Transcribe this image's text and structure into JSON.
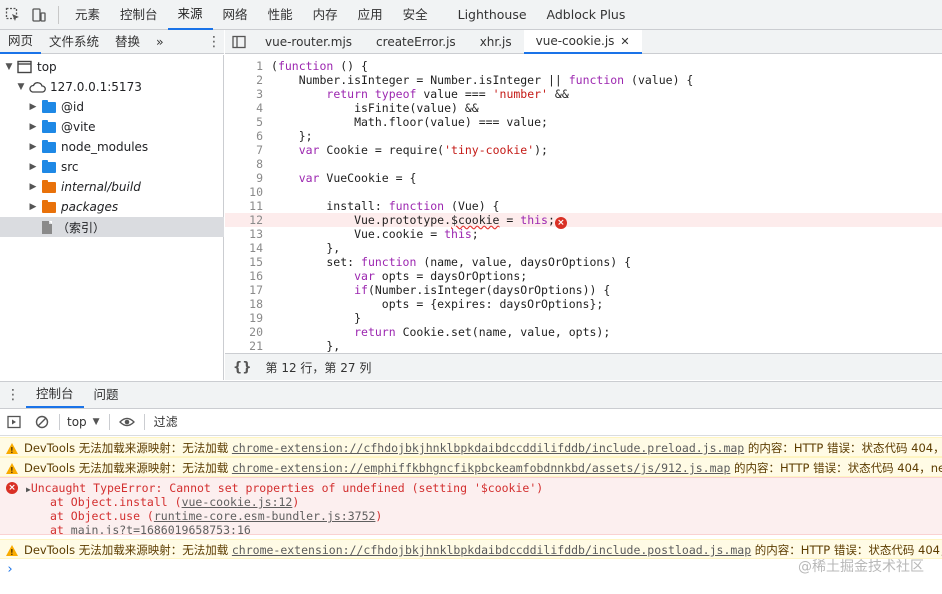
{
  "topbar": {
    "tabs": [
      "元素",
      "控制台",
      "来源",
      "网络",
      "性能",
      "内存",
      "应用",
      "安全",
      "Lighthouse",
      "Adblock Plus"
    ],
    "active_tab": "来源"
  },
  "navigator": {
    "tabs": [
      "网页",
      "文件系统",
      "替换"
    ],
    "more": "»",
    "kebab": "⋮",
    "tree": [
      {
        "label": "top",
        "icon": "frame-icon",
        "level": 0,
        "expanded": true
      },
      {
        "label": "127.0.0.1:5173",
        "icon": "cloud-icon",
        "level": 1,
        "expanded": true
      },
      {
        "label": "@id",
        "icon": "folder-icon",
        "color": "#1e88e5",
        "level": 2
      },
      {
        "label": "@vite",
        "icon": "folder-icon",
        "color": "#1e88e5",
        "level": 2
      },
      {
        "label": "node_modules",
        "icon": "folder-icon",
        "color": "#1e88e5",
        "level": 2
      },
      {
        "label": "src",
        "icon": "folder-icon",
        "color": "#1e88e5",
        "level": 2
      },
      {
        "label": "internal/build",
        "icon": "folder-icon",
        "color": "#e8710a",
        "level": 2,
        "italic": true
      },
      {
        "label": "packages",
        "icon": "folder-icon",
        "color": "#e8710a",
        "level": 2,
        "italic": true
      },
      {
        "label": "（索引）",
        "icon": "file-icon",
        "level": 2,
        "selected": true
      }
    ]
  },
  "editor": {
    "tabs": [
      {
        "label": "vue-router.mjs"
      },
      {
        "label": "createError.js"
      },
      {
        "label": "xhr.js"
      },
      {
        "label": "vue-cookie.js",
        "active": true,
        "close": "✕"
      }
    ],
    "error_line": 12,
    "lines": [
      "(function () {",
      "    Number.isInteger = Number.isInteger || function (value) {",
      "        return typeof value === 'number' &&",
      "            isFinite(value) &&",
      "            Math.floor(value) === value;",
      "    };",
      "    var Cookie = require('tiny-cookie');",
      "",
      "    var VueCookie = {",
      "",
      "        install: function (Vue) {",
      "            Vue.prototype.$cookie = this;",
      "            Vue.cookie = this;",
      "        },",
      "        set: function (name, value, daysOrOptions) {",
      "            var opts = daysOrOptions;",
      "            if(Number.isInteger(daysOrOptions)) {",
      "                opts = {expires: daysOrOptions};",
      "            }",
      "            return Cookie.set(name, value, opts);",
      "        },"
    ],
    "status": {
      "pretty_icon": "{}",
      "cursor": "第 12 行，第 27 列"
    }
  },
  "drawer": {
    "tabs": [
      "控制台",
      "问题"
    ],
    "active_tab": "控制台",
    "toolbar": {
      "context": "top",
      "filter_placeholder": "过滤"
    }
  },
  "console": {
    "warn1": {
      "prefix": "DevTools 无法加载来源映射：无法加载 ",
      "link": "chrome-extension://cfhdojbkjhnklbpkdaibdccddilifddb/include.preload.js.map",
      "suffix": " 的内容：HTTP 错误：状态代码 404，"
    },
    "warn2": {
      "prefix": "DevTools 无法加载来源映射：无法加载 ",
      "link": "chrome-extension://emphiffkbhgncfikpbckeamfobdnnkbd/assets/js/912.js.map",
      "suffix": " 的内容：HTTP 错误：状态代码 404，ne"
    },
    "error": {
      "message": "Uncaught TypeError: Cannot set properties of undefined (setting '$cookie')",
      "stack": [
        {
          "text": "at Object.install (",
          "link": "vue-cookie.js:12",
          "end": ")"
        },
        {
          "text": "at Object.use (",
          "link": "runtime-core.esm-bundler.js:3752",
          "end": ")"
        },
        {
          "text": "at ",
          "link": "main.js?t=1686019658753:16",
          "end": ""
        }
      ]
    },
    "warn3": {
      "prefix": "DevTools 无法加载来源映射：无法加载 ",
      "link": "chrome-extension://cfhdojbkjhnklbpkdaibdccddilifddb/include.postload.js.map",
      "suffix": " 的内容：HTTP 错误：状态代码 404，"
    },
    "prompt": "›",
    "watermark": "@稀土掘金技术社区"
  }
}
